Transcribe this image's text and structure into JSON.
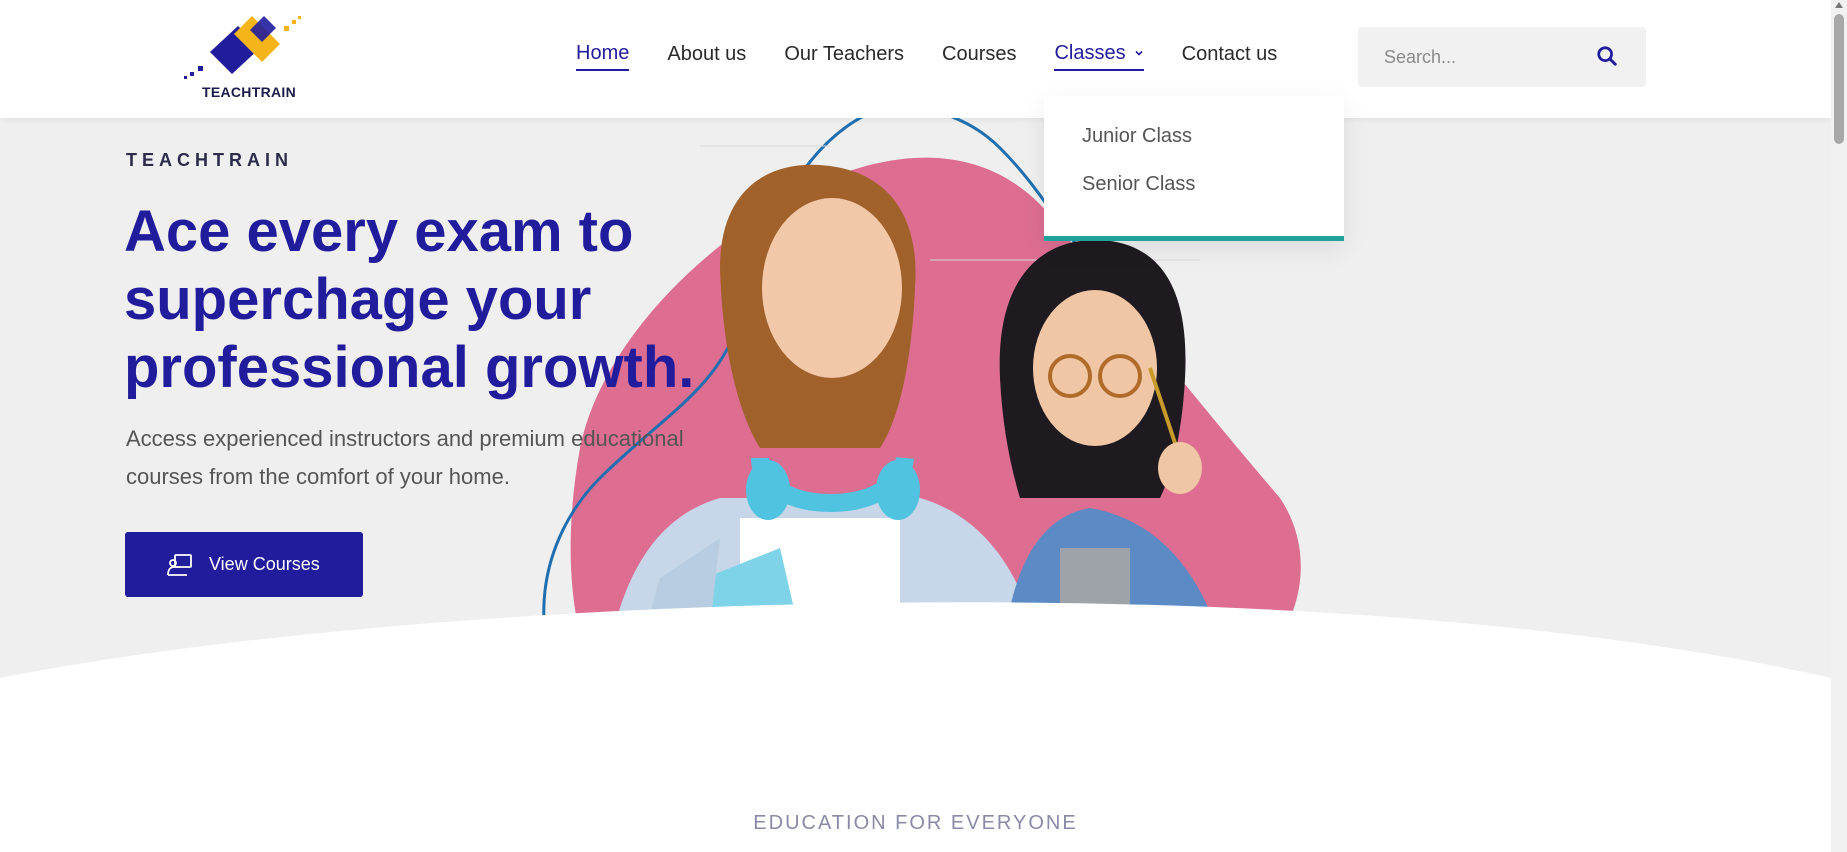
{
  "brand": {
    "name": "TEACHTRAIN",
    "logo_icon": "teachtrain-logo-icon"
  },
  "nav": {
    "items": [
      {
        "label": "Home",
        "state": "active"
      },
      {
        "label": "About us"
      },
      {
        "label": "Our Teachers"
      },
      {
        "label": "Courses"
      },
      {
        "label": "Classes",
        "state": "open",
        "has_dropdown": true
      },
      {
        "label": "Contact us"
      }
    ]
  },
  "dropdown": {
    "items": [
      "Junior Class",
      "Senior Class"
    ]
  },
  "search": {
    "placeholder": "Search...",
    "icon": "search-icon"
  },
  "hero": {
    "kicker": "TEACHTRAIN",
    "headline": "Ace every exam to superchage your professional growth.",
    "subtext": "Access experienced instructors and premium educational courses from the comfort of your home.",
    "cta_label": "View Courses",
    "cta_icon": "teacher-board-icon"
  },
  "section": {
    "label": "EDUCATION FOR EVERYONE"
  },
  "colors": {
    "brand_primary": "#211c9c",
    "brand_accent": "#f4b41a",
    "blob": "#dd6e92",
    "dropdown_border": "#1fa39a",
    "hero_bg": "#efefef"
  }
}
